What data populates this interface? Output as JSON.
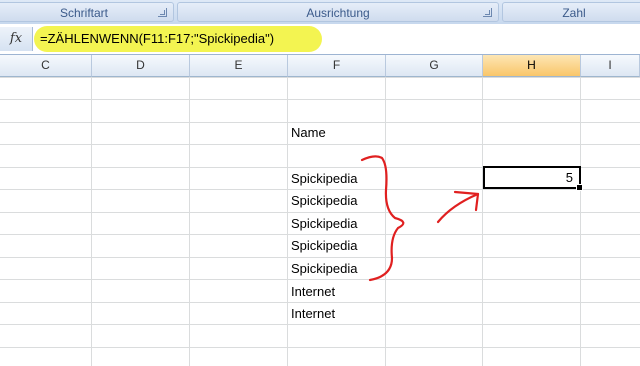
{
  "ribbon": {
    "groups": [
      {
        "label": "Schriftart"
      },
      {
        "label": "Ausrichtung"
      },
      {
        "label": "Zahl"
      }
    ]
  },
  "formula_bar": {
    "fx_icon": "fx-icon",
    "formula": "=ZÄHLENWENN(F11:F17;\"Spickipedia\")",
    "highlight_color": "#f2f33e"
  },
  "columns": [
    "C",
    "D",
    "E",
    "F",
    "G",
    "H",
    "I"
  ],
  "selected_column": "H",
  "cells": {
    "f_header": "Name",
    "f_values": [
      "Spickipedia",
      "Spickipedia",
      "Spickipedia",
      "Spickipedia",
      "Spickipedia",
      "Internet",
      "Internet"
    ],
    "h_result": "5"
  },
  "annotation_color": "#e02020"
}
